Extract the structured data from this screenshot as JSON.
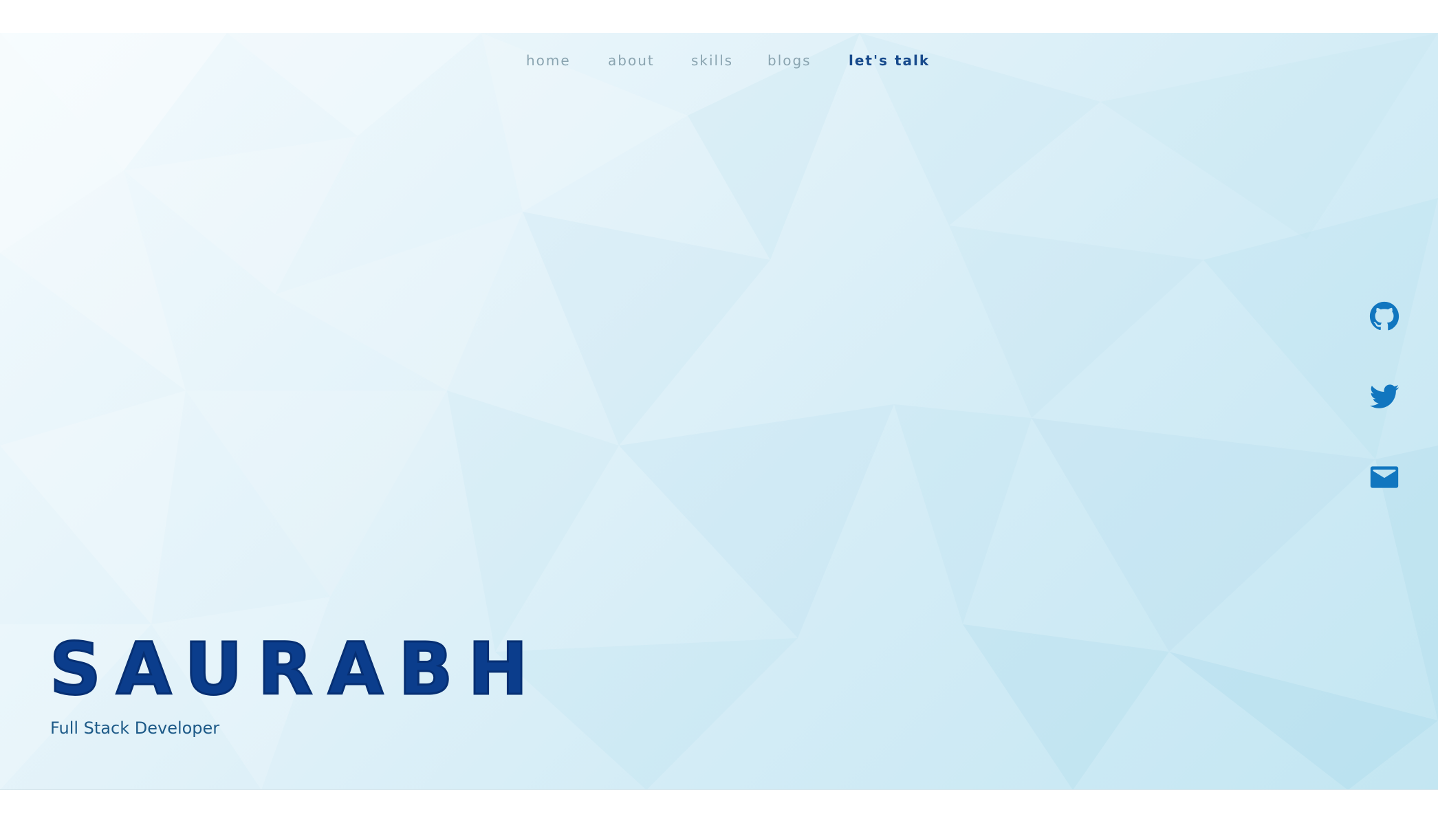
{
  "nav": {
    "items": [
      {
        "label": "home"
      },
      {
        "label": "about"
      },
      {
        "label": "skills"
      },
      {
        "label": "blogs"
      },
      {
        "label": "let's talk",
        "active": true
      }
    ]
  },
  "social": [
    {
      "icon": "github-icon"
    },
    {
      "icon": "twitter-icon"
    },
    {
      "icon": "mail-icon"
    }
  ],
  "hero": {
    "name": "SAURABH",
    "role": "Full Stack Developer"
  },
  "colors": {
    "nav_text": "#8aa4b0",
    "nav_active": "#174a8c",
    "title": "#0b3d8c",
    "subtitle": "#1d5a88",
    "social_icon": "#1176bf",
    "background_light": "#f3fafd",
    "background_dark": "#c3e6f2"
  }
}
